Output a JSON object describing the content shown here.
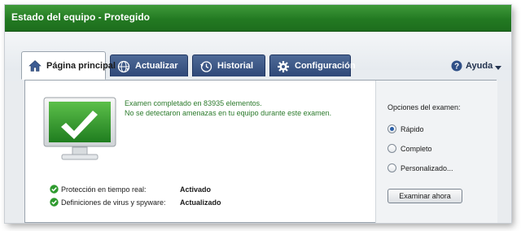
{
  "window": {
    "title": "Estado del equipo - Protegido"
  },
  "tabs": [
    {
      "label": "Página principal",
      "icon": "home-icon",
      "active": true
    },
    {
      "label": "Actualizar",
      "icon": "globe-update-icon",
      "active": false
    },
    {
      "label": "Historial",
      "icon": "history-clock-icon",
      "active": false
    },
    {
      "label": "Configuración",
      "icon": "gear-icon",
      "active": false
    }
  ],
  "help": {
    "label": "Ayuda",
    "icon": "help-question-icon"
  },
  "scan_result": {
    "line1": "Examen completado en 83935 elementos.",
    "line2": "No se detectaron amenazas en tu equipo durante este examen."
  },
  "status": [
    {
      "name": "Protección en tiempo real:",
      "value": "Activado",
      "icon": "check-ok-icon"
    },
    {
      "name": "Definiciones de virus y spyware:",
      "value": "Actualizado",
      "icon": "check-ok-icon"
    }
  ],
  "scan_options": {
    "title": "Opciones del examen:",
    "options": [
      {
        "label": "Rápido",
        "selected": true
      },
      {
        "label": "Completo",
        "selected": false
      },
      {
        "label": "Personalizado...",
        "selected": false
      }
    ],
    "button_label": "Examinar ahora"
  },
  "colors": {
    "titlebar_green": "#237a22",
    "message_green": "#2b7a2b",
    "tab_blue": "#3a5586",
    "monitor_green": "#2e9a2e"
  }
}
